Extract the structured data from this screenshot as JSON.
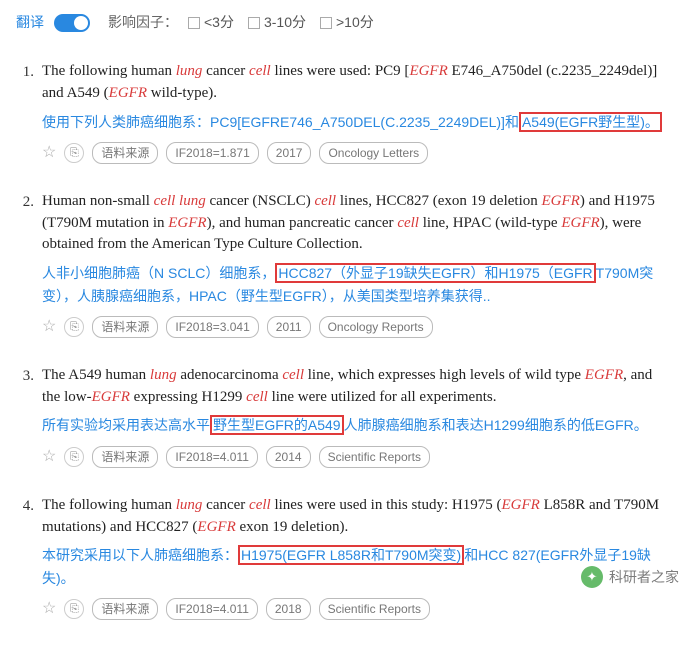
{
  "top": {
    "translate": "翻译",
    "if_label": "影响因子：",
    "filters": [
      "<3分",
      "3-10分",
      ">10分"
    ]
  },
  "entries": [
    {
      "num": "1.",
      "eng_parts": [
        "The following human ",
        {
          "kw": "lung"
        },
        " cancer ",
        {
          "kw": "cell"
        },
        " lines were used: PC9 [",
        {
          "gene": "EGFR"
        },
        " E746_A750del (c.2235_2249del)] and A549 (",
        {
          "gene": "EGFR"
        },
        " wild-type)."
      ],
      "cn_plain": "使用下列人类肺癌细胞系：PC9[EGFRE746_A750DEL(C.2235_2249DEL)]和",
      "cn_hl": "A549(EGFR野生型)。",
      "cn_tail": "",
      "src": "语料来源",
      "if": "IF2018=1.871",
      "year": "2017",
      "journal": "Oncology Letters"
    },
    {
      "num": "2.",
      "eng_parts": [
        "Human non-small ",
        {
          "kw": "cell lung"
        },
        " cancer (NSCLC) ",
        {
          "kw": "cell"
        },
        " lines, HCC827 (exon 19 deletion ",
        {
          "gene": "EGFR"
        },
        ") and H1975 (T790M mutation in ",
        {
          "gene": "EGFR"
        },
        "), and human pancreatic cancer ",
        {
          "kw": "cell"
        },
        " line, HPAC (wild-type ",
        {
          "gene": "EGFR"
        },
        "), were obtained from the American Type Culture Collection."
      ],
      "cn_plain": "人非小细胞肺癌（N SCLC）细胞系，",
      "cn_hl": "HCC827（外显子19缺失EGFR）和H1975（EGFR",
      "cn_tail": "T790M突变），人胰腺癌细胞系，HPAC（野生型EGFR），从美国类型培养集获得..",
      "src": "语料来源",
      "if": "IF2018=3.041",
      "year": "2011",
      "journal": "Oncology Reports"
    },
    {
      "num": "3.",
      "eng_parts": [
        "The A549 human ",
        {
          "kw": "lung"
        },
        " adenocarcinoma ",
        {
          "kw": "cell"
        },
        " line, which expresses high levels of wild type ",
        {
          "gene": "EGFR"
        },
        ", and the low-",
        {
          "gene": "EGFR"
        },
        " expressing H1299 ",
        {
          "kw": "cell"
        },
        " line were utilized for all experiments."
      ],
      "cn_plain": "所有实验均采用表达高水平",
      "cn_hl": "野生型EGFR的A549",
      "cn_tail": "人肺腺癌细胞系和表达H1299细胞系的低EGFR。",
      "src": "语料来源",
      "if": "IF2018=4.011",
      "year": "2014",
      "journal": "Scientific Reports"
    },
    {
      "num": "4.",
      "eng_parts": [
        "The following human ",
        {
          "kw": "lung"
        },
        " cancer ",
        {
          "kw": "cell"
        },
        " lines were used in this study: H1975 (",
        {
          "gene": "EGFR"
        },
        " L858R and T790M mutations) and HCC827 (",
        {
          "gene": "EGFR"
        },
        " exon 19 deletion)."
      ],
      "cn_plain": "本研究采用以下人肺癌细胞系：",
      "cn_hl": "H1975(EGFR L858R和T790M突变)",
      "cn_tail": "和HCC 827(EGFR外显子19缺失)。",
      "src": "语料来源",
      "if": "IF2018=4.011",
      "year": "2018",
      "journal": "Scientific Reports"
    }
  ],
  "watermark": "科研者之家"
}
